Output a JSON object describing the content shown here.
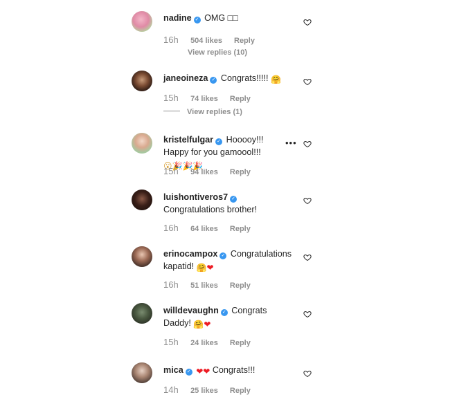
{
  "comments": [
    {
      "username": "nadine",
      "text": "OMG □□",
      "time": "16h",
      "likes": "504 likes",
      "reply": "Reply",
      "view_replies": "View replies (10)"
    },
    {
      "username": "janeoineza",
      "text": "Congrats!!!!!",
      "emoji": "🤗",
      "time": "15h",
      "likes": "74 likes",
      "reply": "Reply",
      "view_replies": "View replies (1)"
    },
    {
      "username": "kristelfulgar",
      "text": "Hooooy!!! Happy for you gamoool!!!",
      "emoji": "😮🎉🎉🎉",
      "time": "15h",
      "likes": "94 likes",
      "reply": "Reply",
      "more": "•••"
    },
    {
      "username": "luishontiveros7",
      "text": "Congratulations brother!",
      "time": "16h",
      "likes": "64 likes",
      "reply": "Reply"
    },
    {
      "username": "erinocampox",
      "text": "Congratulations kapatid!",
      "emoji": "🤗❤",
      "time": "16h",
      "likes": "51 likes",
      "reply": "Reply"
    },
    {
      "username": "willdevaughn",
      "text": "Congrats Daddy!",
      "emoji": "🤗❤",
      "time": "15h",
      "likes": "24 likes",
      "reply": "Reply"
    },
    {
      "username": "mica",
      "text": "Congrats!!!",
      "emoji_before": "❤❤",
      "time": "14h",
      "likes": "25 likes",
      "reply": "Reply"
    }
  ],
  "icons": {
    "like": "heart-outline-icon",
    "verified": "verified-badge-icon",
    "more": "more-options-icon"
  },
  "colors": {
    "verified": "#3897f0",
    "meta": "#8e8e8e",
    "heart_emoji": "#ed1c24"
  }
}
